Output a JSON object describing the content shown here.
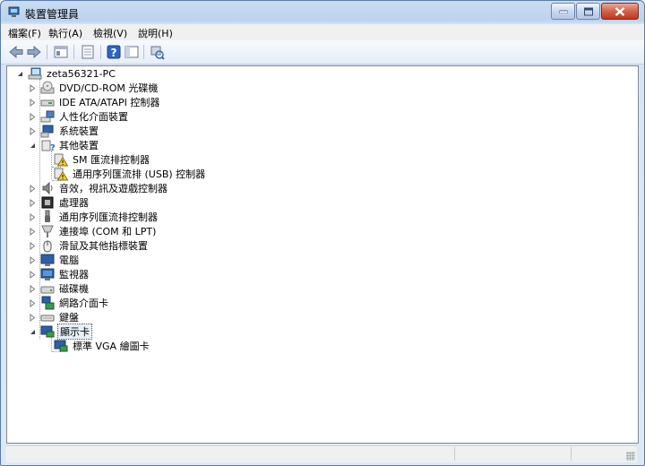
{
  "window": {
    "title": "裝置管理員",
    "accent": "#5a7aa6"
  },
  "menu": [
    "檔案(F)",
    "執行(A)",
    "檢視(V)",
    "說明(H)"
  ],
  "toolbar": [
    "back-icon",
    "forward-icon",
    "properties-view-icon",
    "properties-icon",
    "help-icon",
    "console-tree-icon",
    "scan-hardware-icon"
  ],
  "tree": {
    "root": {
      "label": "zeta56321-PC",
      "icon": "computer-icon",
      "expanded": true
    },
    "items": [
      {
        "label": "DVD/CD-ROM 光碟機",
        "icon": "dvd-drive-icon",
        "expanded": false
      },
      {
        "label": "IDE ATA/ATAPI 控制器",
        "icon": "ide-controller-icon",
        "expanded": false
      },
      {
        "label": "人性化介面裝置",
        "icon": "hid-icon",
        "expanded": false
      },
      {
        "label": "系統裝置",
        "icon": "system-devices-icon",
        "expanded": false
      },
      {
        "label": "其他裝置",
        "icon": "other-devices-icon",
        "expanded": true,
        "children": [
          {
            "label": "SM 匯流排控制器",
            "icon": "warning-device-icon"
          },
          {
            "label": "通用序列匯流排 (USB) 控制器",
            "icon": "warning-device-icon"
          }
        ]
      },
      {
        "label": "音效，視訊及遊戲控制器",
        "icon": "sound-icon",
        "expanded": false
      },
      {
        "label": "處理器",
        "icon": "processor-icon",
        "expanded": false
      },
      {
        "label": "通用序列匯流排控制器",
        "icon": "usb-icon",
        "expanded": false
      },
      {
        "label": "連接埠 (COM 和 LPT)",
        "icon": "port-icon",
        "expanded": false
      },
      {
        "label": "滑鼠及其他指標裝置",
        "icon": "mouse-icon",
        "expanded": false
      },
      {
        "label": "電腦",
        "icon": "computer-monitor-icon",
        "expanded": false
      },
      {
        "label": "監視器",
        "icon": "monitor-icon",
        "expanded": false
      },
      {
        "label": "磁碟機",
        "icon": "disk-drive-icon",
        "expanded": false
      },
      {
        "label": "網路介面卡",
        "icon": "network-adapter-icon",
        "expanded": false
      },
      {
        "label": "鍵盤",
        "icon": "keyboard-icon",
        "expanded": false
      },
      {
        "label": "顯示卡",
        "icon": "display-adapter-icon",
        "expanded": true,
        "selected": true,
        "children": [
          {
            "label": "標準 VGA 繪圖卡",
            "icon": "display-adapter-icon"
          }
        ]
      }
    ]
  },
  "statusbar": [
    "",
    "",
    ""
  ]
}
